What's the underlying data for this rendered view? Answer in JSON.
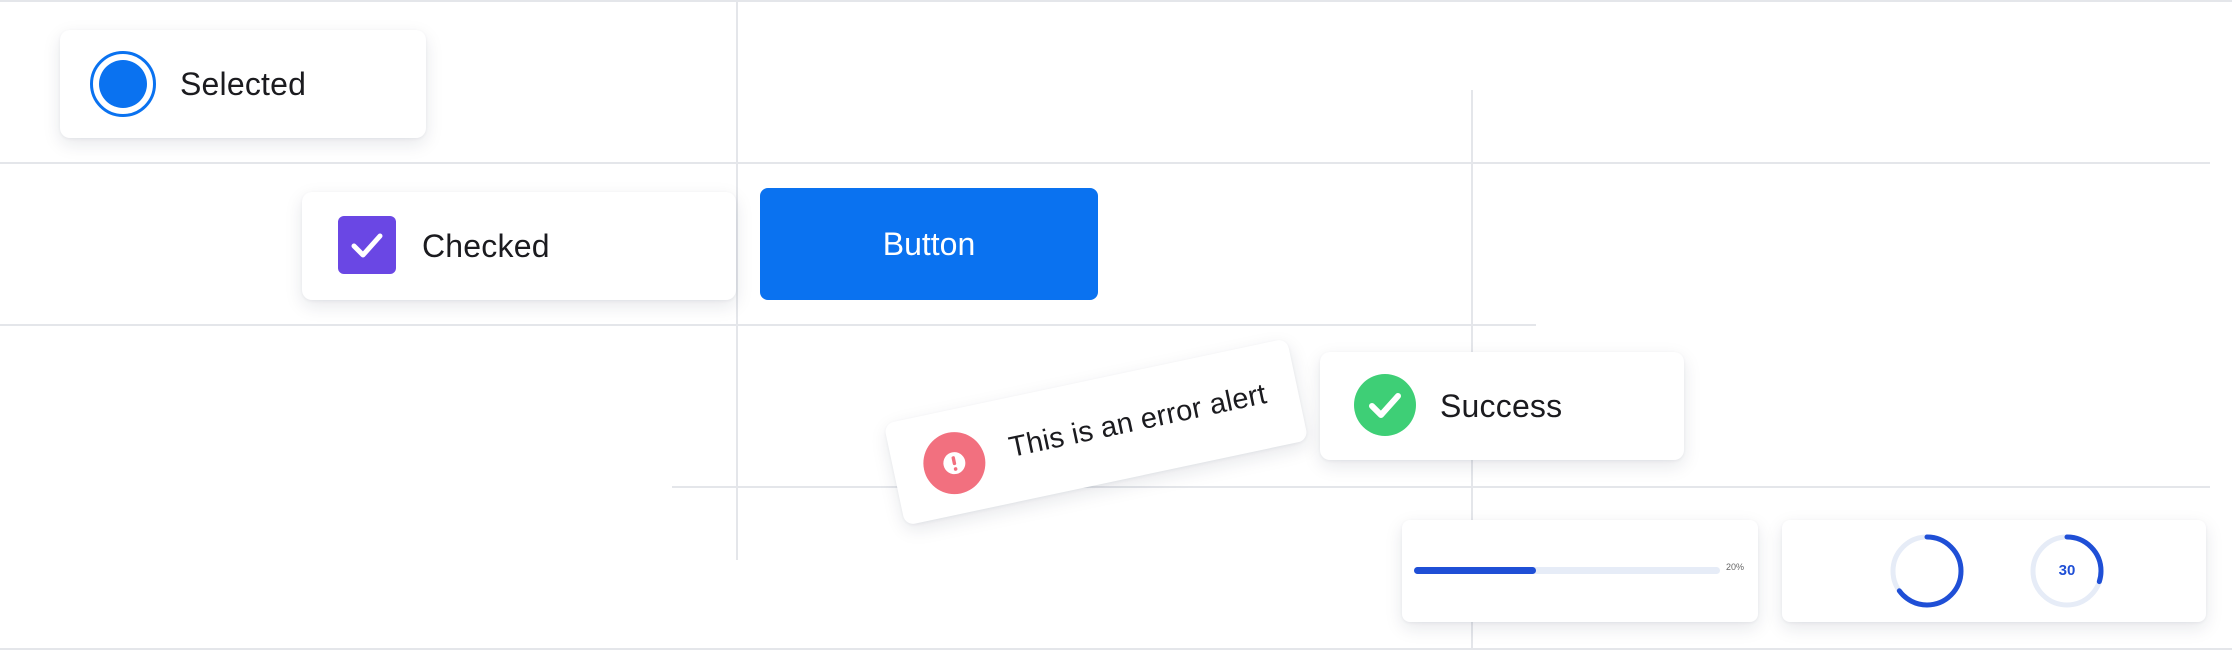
{
  "colors": {
    "primary": "#0a72f0",
    "checkbox": "#6a47e4",
    "error": "#f2707f",
    "success": "#3ecf76",
    "progress": "#1f4fd6",
    "track": "#e6ecf7"
  },
  "radio": {
    "label": "Selected",
    "checked": true,
    "icon": "radio-filled-icon"
  },
  "checkbox": {
    "label": "Checked",
    "checked": true,
    "icon": "checkmark-icon"
  },
  "button": {
    "label": "Button"
  },
  "error_alert": {
    "text": "This is an error alert",
    "icon": "exclamation-icon"
  },
  "success_alert": {
    "text": "Success",
    "icon": "check-circle-icon"
  },
  "progress_bar": {
    "value": 0.4,
    "label": "20%"
  },
  "circular_progress": {
    "spinner_value": 0.65,
    "labeled_value": 0.3,
    "labeled_text": "30"
  }
}
